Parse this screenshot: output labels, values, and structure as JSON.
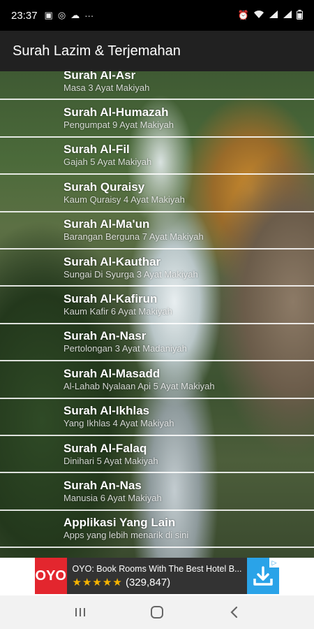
{
  "status_bar": {
    "time": "23:37",
    "left_icons": [
      "image-icon",
      "instagram-icon",
      "cloud-icon",
      "more-icon"
    ],
    "right_icons": [
      "alarm-icon",
      "wifi-icon",
      "signal-icon",
      "signal-icon",
      "battery-icon"
    ]
  },
  "app_bar": {
    "title": "Surah Lazim & Terjemahan"
  },
  "surahs": [
    {
      "name": "Surah Al-Asr",
      "desc": "Masa 3 Ayat Makiyah"
    },
    {
      "name": "Surah Al-Humazah",
      "desc": "Pengumpat 9 Ayat Makiyah"
    },
    {
      "name": "Surah Al-Fil",
      "desc": "Gajah 5 Ayat Makiyah"
    },
    {
      "name": "Surah Quraisy",
      "desc": "Kaum Quraisy 4 Ayat Makiyah"
    },
    {
      "name": "Surah Al-Ma'un",
      "desc": "Barangan Berguna 7 Ayat Makiyah"
    },
    {
      "name": "Surah Al-Kauthar",
      "desc": "Sungai Di Syurga 3 Ayat Makiyah"
    },
    {
      "name": "Surah Al-Kafirun",
      "desc": "Kaum Kafir 6 Ayat Makiyah"
    },
    {
      "name": "Surah An-Nasr",
      "desc": "Pertolongan 3 Ayat Madaniyah"
    },
    {
      "name": "Surah Al-Masadd",
      "desc": "Al-Lahab Nyalaan Api 5 Ayat Makiyah"
    },
    {
      "name": "Surah Al-Ikhlas",
      "desc": "Yang Ikhlas 4 Ayat Makiyah"
    },
    {
      "name": "Surah Al-Falaq",
      "desc": "Dinihari 5 Ayat Makiyah"
    },
    {
      "name": "Surah An-Nas",
      "desc": "Manusia 6 Ayat Makiyah"
    },
    {
      "name": "Applikasi Yang Lain",
      "desc": "Apps yang lebih menarik di sini"
    }
  ],
  "ad": {
    "logo": "OYO",
    "title": "OYO: Book Rooms With The Best Hotel B...",
    "stars": "★★★★★",
    "rating_count": "(329,847)",
    "install_icon": "download-icon",
    "logo_color": "#e3262e",
    "install_color": "#2aa3e8"
  },
  "nav_bar": {
    "recent_icon": "recent-apps-icon",
    "home_icon": "home-icon",
    "back_icon": "back-icon"
  }
}
